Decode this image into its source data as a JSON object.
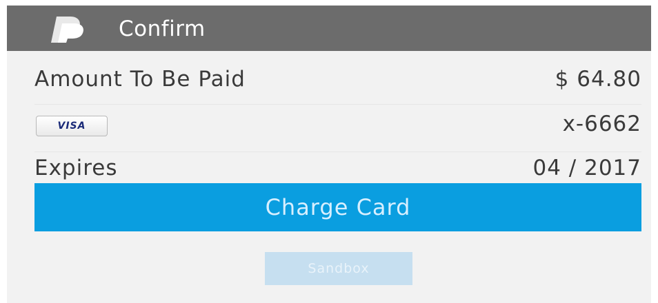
{
  "header": {
    "title": "Confirm",
    "logo_icon": "paypal-logo-icon",
    "background_color": "#6c6c6c"
  },
  "payment": {
    "amount_label": "Amount To Be Paid",
    "amount_value": "$ 64.80",
    "card_brand": "VISA",
    "card_number": "x-6662",
    "expires_label": "Expires",
    "expires_value": "04 / 2017"
  },
  "actions": {
    "charge_label": "Charge Card",
    "charge_color": "#0a9ee0"
  },
  "environment": {
    "badge_label": "Sandbox"
  }
}
